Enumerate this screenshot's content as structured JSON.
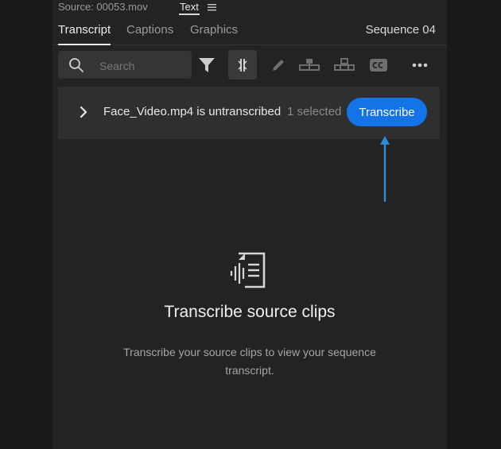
{
  "header": {
    "source_label": "Source: 00053.mov",
    "text_tab_label": "Text",
    "menu_icon": "hamburger-menu-icon"
  },
  "tabs": [
    {
      "label": "Transcript",
      "active": true
    },
    {
      "label": "Captions",
      "active": false
    },
    {
      "label": "Graphics",
      "active": false
    }
  ],
  "sequence_label": "Sequence 04",
  "toolbar": {
    "search_placeholder": "Search",
    "tools": [
      "filter-icon",
      "split-icon",
      "pencil-icon",
      "merge-icon",
      "merge-alt-icon",
      "cc-icon",
      "more-icon"
    ]
  },
  "banner": {
    "message": "Face_Video.mp4 is untranscribed",
    "selected_text": "1 selected",
    "button_label": "Transcribe"
  },
  "empty_state": {
    "title": "Transcribe source clips",
    "description": "Transcribe your source clips to view your sequence transcript."
  },
  "colors": {
    "accent": "#1473e6",
    "arrow": "#2d8ad9",
    "panel_bg": "#232323",
    "banner_bg": "#2f2f2f"
  }
}
